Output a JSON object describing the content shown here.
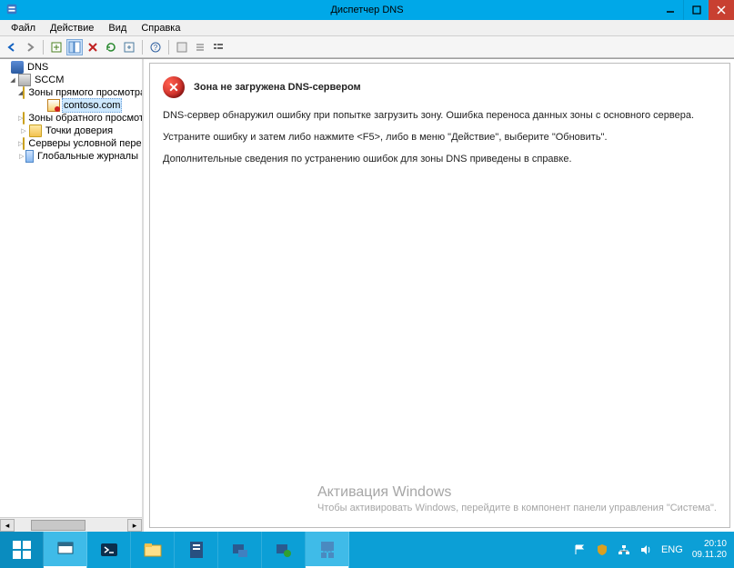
{
  "window": {
    "title": "Диспетчер DNS"
  },
  "menu": {
    "file": "Файл",
    "action": "Действие",
    "view": "Вид",
    "help": "Справка"
  },
  "tree": {
    "root": "DNS",
    "server": "SCCM",
    "fwd_zones": "Зоны прямого просмотра",
    "zone": "contoso.com",
    "rev_zones": "Зоны обратного просмотра",
    "trust_points": "Точки доверия",
    "cond_fwd": "Серверы условной пересылки",
    "global_logs": "Глобальные журналы"
  },
  "error": {
    "title": "Зона не загружена DNS-сервером",
    "p1": "DNS-сервер обнаружил ошибку при попытке загрузить зону. Ошибка переноса данных зоны с основного сервера.",
    "p2": "Устраните ошибку и затем либо нажмите <F5>, либо в меню \"Действие\", выберите \"Обновить\".",
    "p3": "Дополнительные сведения по устранению ошибок для зоны DNS приведены в справке."
  },
  "watermark": {
    "line1": "Активация Windows",
    "line2": "Чтобы активировать Windows, перейдите в компонент панели управления \"Система\"."
  },
  "tray": {
    "lang": "ENG",
    "time": "20:10",
    "date": "09.11.20"
  }
}
